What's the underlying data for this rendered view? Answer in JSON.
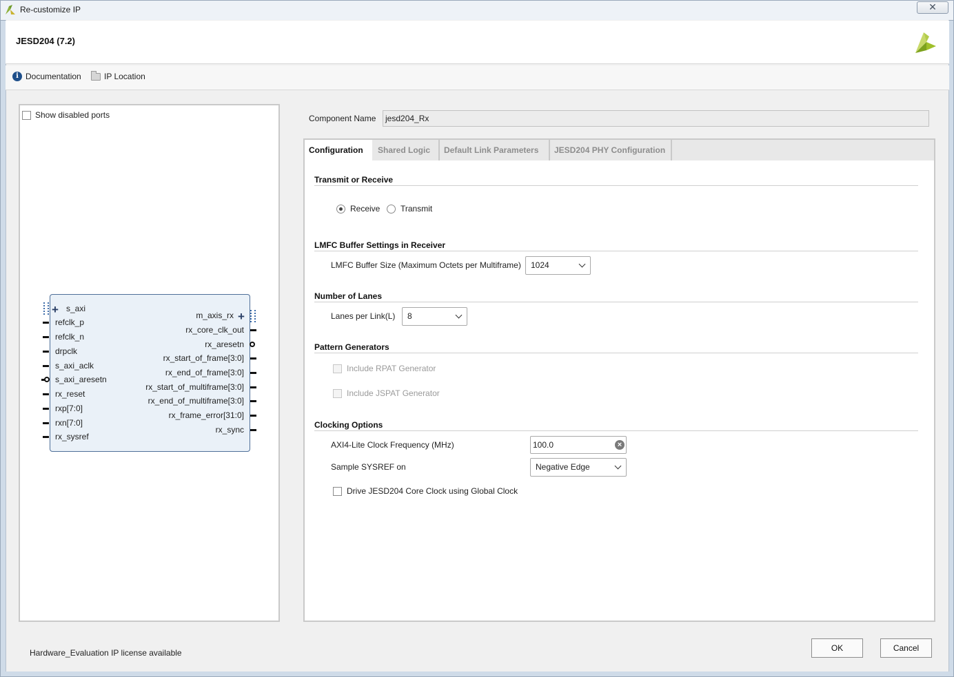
{
  "window": {
    "title": "Re-customize IP",
    "close_glyph": "✕"
  },
  "header": {
    "ip_name": "JESD204 (7.2)"
  },
  "toolbar": {
    "documentation": "Documentation",
    "ip_location": "IP Location"
  },
  "left_panel": {
    "show_disabled_ports": "Show disabled ports",
    "block": {
      "left_ports": [
        "s_axi",
        "refclk_p",
        "refclk_n",
        "drpclk",
        "s_axi_aclk",
        "s_axi_aresetn",
        "rx_reset",
        "rxp[7:0]",
        "rxn[7:0]",
        "rx_sysref"
      ],
      "right_ports": [
        "m_axis_rx",
        "rx_core_clk_out",
        "rx_aresetn",
        "rx_start_of_frame[3:0]",
        "rx_end_of_frame[3:0]",
        "rx_start_of_multiframe[3:0]",
        "rx_end_of_multiframe[3:0]",
        "rx_frame_error[31:0]",
        "rx_sync"
      ]
    }
  },
  "component": {
    "label": "Component Name",
    "value": "jesd204_Rx"
  },
  "tabs": [
    "Configuration",
    "Shared Logic",
    "Default Link Parameters",
    "JESD204 PHY Configuration"
  ],
  "config": {
    "tx_rx": {
      "heading": "Transmit or Receive",
      "receive": "Receive",
      "transmit": "Transmit",
      "selected": "Receive"
    },
    "lmfc": {
      "heading": "LMFC Buffer Settings in Receiver",
      "label": "LMFC Buffer Size (Maximum Octets per Multiframe)",
      "value": "1024"
    },
    "lanes": {
      "heading": "Number of Lanes",
      "label": "Lanes per Link(L)",
      "value": "8"
    },
    "pattern": {
      "heading": "Pattern Generators",
      "rpat": "Include RPAT Generator",
      "jspat": "Include JSPAT Generator"
    },
    "clocking": {
      "heading": "Clocking Options",
      "axi_label": "AXI4-Lite Clock Frequency (MHz)",
      "axi_value": "100.0",
      "sysref_label": "Sample SYSREF on",
      "sysref_value": "Negative Edge",
      "global_clock": "Drive JESD204 Core Clock using Global Clock"
    }
  },
  "footer": {
    "license": "Hardware_Evaluation IP license available",
    "ok": "OK",
    "cancel": "Cancel"
  },
  "colors": {
    "block_fill": "#eaf1f8",
    "block_border": "#4d6e98",
    "logo": "#9fbf2a"
  }
}
